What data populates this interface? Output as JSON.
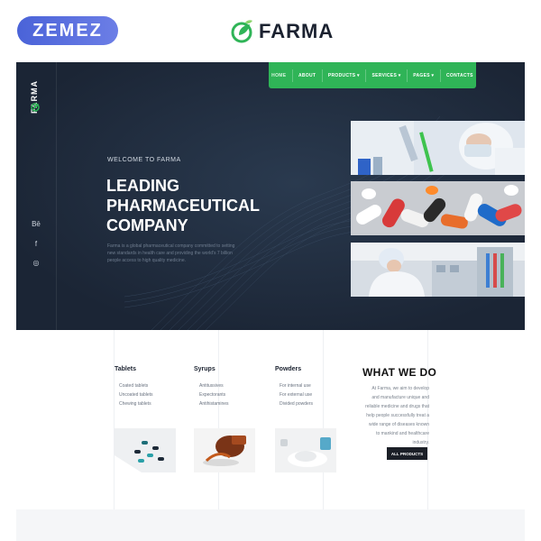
{
  "promo": {
    "zemez_label": "ZEMEZ"
  },
  "brand": {
    "name": "FARMA",
    "accent": "#2fb457"
  },
  "sidebar": {
    "logo_text": "FARMA",
    "social": [
      "Bē",
      "f",
      "◎"
    ]
  },
  "nav": {
    "items": [
      {
        "label": "HOME",
        "active": true
      },
      {
        "label": "ABOUT"
      },
      {
        "label": "PRODUCTS ▾"
      },
      {
        "label": "SERVICES ▾"
      },
      {
        "label": "PAGES ▾"
      },
      {
        "label": "CONTACTS"
      }
    ]
  },
  "hero": {
    "welcome": "WELCOME TO FARMA",
    "headline": [
      "LEADING",
      "PHARMACEUTICAL",
      "COMPANY"
    ],
    "description": "Farma is a global pharmaceutical company committed to setting new standards in health care and providing the world's 7 billion people access to high quality medicine.",
    "photos": [
      "lab-scientist-photo",
      "pills-photo",
      "lab-worker-photo"
    ]
  },
  "categories": [
    {
      "title": "Tablets",
      "items": [
        "Coated tablets",
        "Uncoated tablets",
        "Chewing tablets"
      ],
      "image": "tablets-photo"
    },
    {
      "title": "Syrups",
      "items": [
        "Antitussives",
        "Expectorants",
        "Antihistamines"
      ],
      "image": "syrup-photo"
    },
    {
      "title": "Powders",
      "items": [
        "For internal use",
        "For external use",
        "Divided powders"
      ],
      "image": "powder-photo"
    }
  ],
  "what_we_do": {
    "title": "WHAT WE DO",
    "text": "At Farma, we aim to develop and manufacture unique and reliable medicine and drugs that help people successfully treat a wide range of diseases known to mankind and healthcare industry.",
    "button": "ALL PRODUCTS"
  }
}
